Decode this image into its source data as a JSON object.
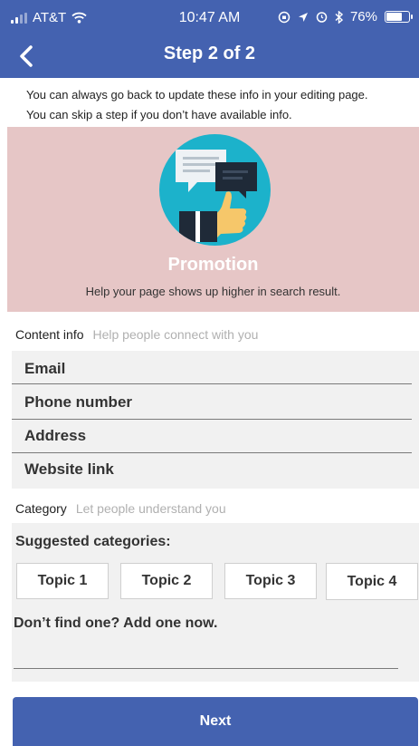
{
  "status_bar": {
    "carrier": "AT&T",
    "time": "10:47 AM",
    "battery_percent": "76%",
    "battery_level": 0.76
  },
  "header": {
    "title": "Step 2 of 2",
    "back_icon": "chevron-left-icon"
  },
  "tips": {
    "line1": "You can always go back to update these info in your editing page.",
    "line2": "You can skip a step if you don’t have available info."
  },
  "banner": {
    "title": "Promotion",
    "subtitle": "Help your page shows up higher in search result.",
    "background": "#e6c6c6",
    "circle_color": "#1cb2cb"
  },
  "content_info": {
    "label": "Content info",
    "hint": "Help people connect with you",
    "fields": [
      "Email",
      "Phone number",
      "Address",
      "Website link"
    ]
  },
  "category": {
    "label": "Category",
    "hint": "Let people understand you",
    "suggested_label": "Suggested categories:",
    "topics": [
      "Topic 1",
      "Topic 2",
      "Topic 3",
      "Topic 4"
    ],
    "add_label": "Don’t find one? Add one now.",
    "add_value": ""
  },
  "next_button": {
    "label": "Next"
  },
  "colors": {
    "brand": "#4462b0",
    "field_background": "#f1f1f1",
    "hint_text": "#b0b0b0"
  }
}
